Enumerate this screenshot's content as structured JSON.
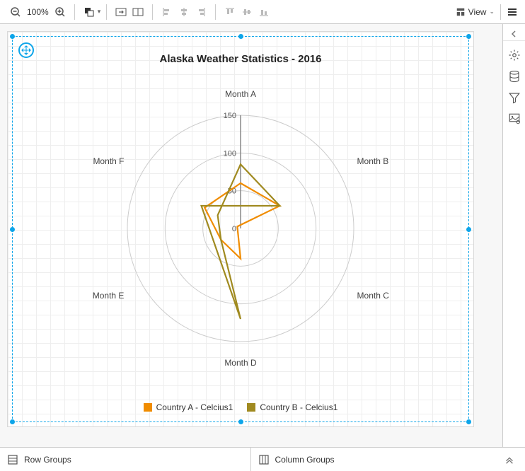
{
  "toolbar": {
    "zoom": "100%",
    "view_label": "View"
  },
  "bottom": {
    "row_groups": "Row Groups",
    "column_groups": "Column Groups"
  },
  "chart_data": {
    "type": "radar",
    "title": "Alaska Weather Statistics - 2016",
    "categories": [
      "Month A",
      "Month B",
      "Month C",
      "Month D",
      "Month E",
      "Month F"
    ],
    "ticks": [
      0,
      50,
      100,
      150
    ],
    "rlim": [
      0,
      150
    ],
    "series": [
      {
        "name": "Country A - Celcius1",
        "color": "#F08C00",
        "values": [
          60,
          60,
          -5,
          40,
          30,
          55
        ]
      },
      {
        "name": "Country B - Celcius1",
        "color": "#A08A20",
        "values": [
          85,
          60,
          -60,
          120,
          30,
          35
        ]
      }
    ]
  }
}
